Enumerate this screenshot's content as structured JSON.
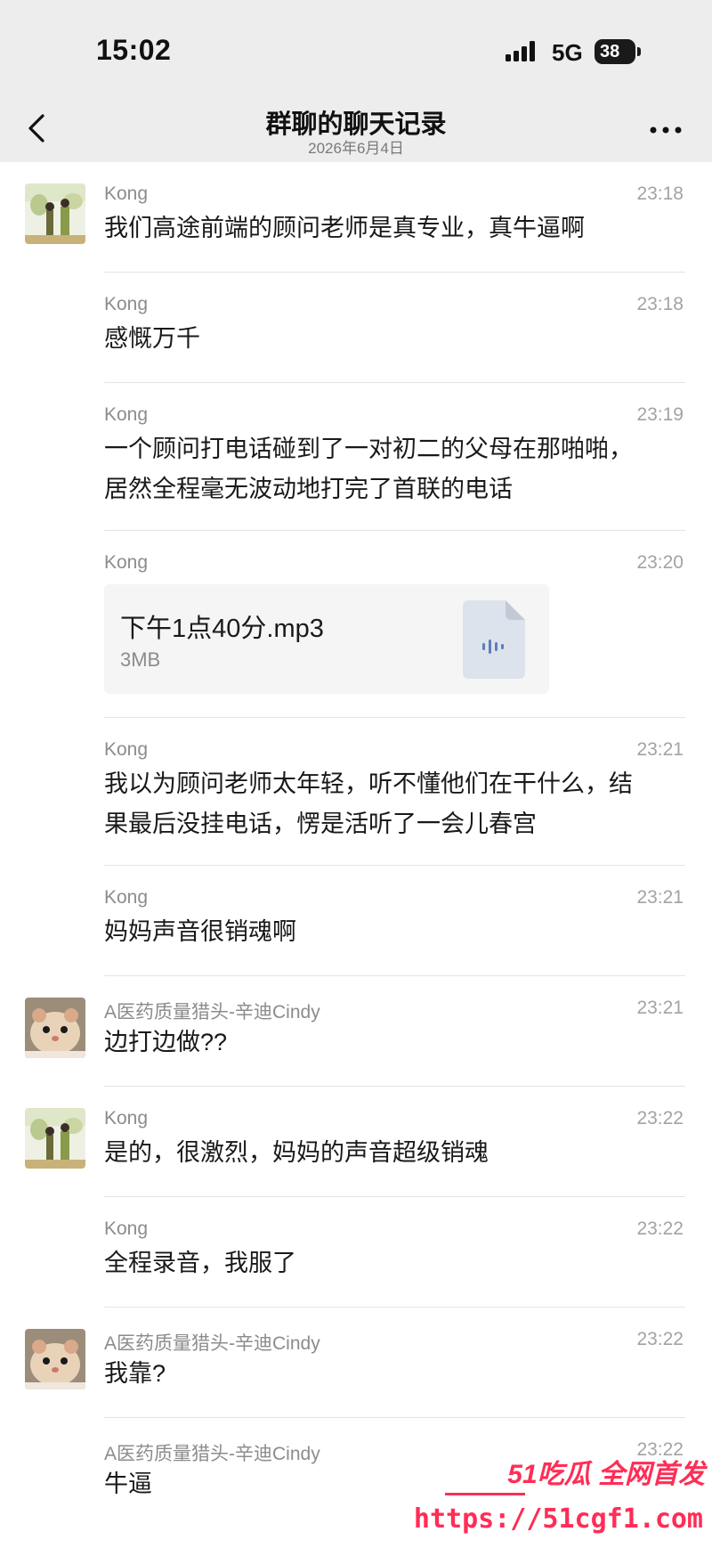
{
  "status": {
    "time": "15:02",
    "network": "5G",
    "battery": "38"
  },
  "nav": {
    "title": "群聊的聊天记录",
    "date": "2026年6月4日"
  },
  "messages": [
    {
      "sender": "Kong",
      "time": "23:18",
      "lines": [
        "我们高途前端的顾问老师是真专业，真牛逼啊"
      ]
    },
    {
      "sender": "Kong",
      "time": "23:18",
      "lines": [
        "感慨万千"
      ]
    },
    {
      "sender": "Kong",
      "time": "23:19",
      "lines": [
        "一个顾问打电话碰到了一对初二的父母在那啪啪，",
        "居然全程毫无波动地打完了首联的电话"
      ]
    },
    {
      "sender": "Kong",
      "time": "23:20",
      "file": {
        "name": "下午1点40分.mp3",
        "size": "3MB"
      }
    },
    {
      "sender": "Kong",
      "time": "23:21",
      "lines": [
        "我以为顾问老师太年轻，听不懂他们在干什么，结",
        "果最后没挂电话，愣是活听了一会儿春宫"
      ]
    },
    {
      "sender": "Kong",
      "time": "23:21",
      "lines": [
        "妈妈声音很销魂啊"
      ]
    },
    {
      "sender": "A医药质量猎头-辛迪Cindy",
      "time": "23:21",
      "lines": [
        "边打边做??"
      ]
    },
    {
      "sender": "Kong",
      "time": "23:22",
      "lines": [
        "是的，很激烈，妈妈的声音超级销魂"
      ]
    },
    {
      "sender": "Kong",
      "time": "23:22",
      "lines": [
        "全程录音，我服了"
      ]
    },
    {
      "sender": "A医药质量猎头-辛迪Cindy",
      "time": "23:22",
      "lines": [
        "我靠?"
      ]
    },
    {
      "sender": "A医药质量猎头-辛迪Cindy",
      "time": "23:22",
      "lines": [
        "牛逼"
      ]
    }
  ],
  "watermark": {
    "brand": "51吃瓜 全网首发",
    "url": "https://51cgf1.com"
  },
  "colors": {
    "accent": "#ff2d55",
    "header_bg": "#ededed"
  }
}
